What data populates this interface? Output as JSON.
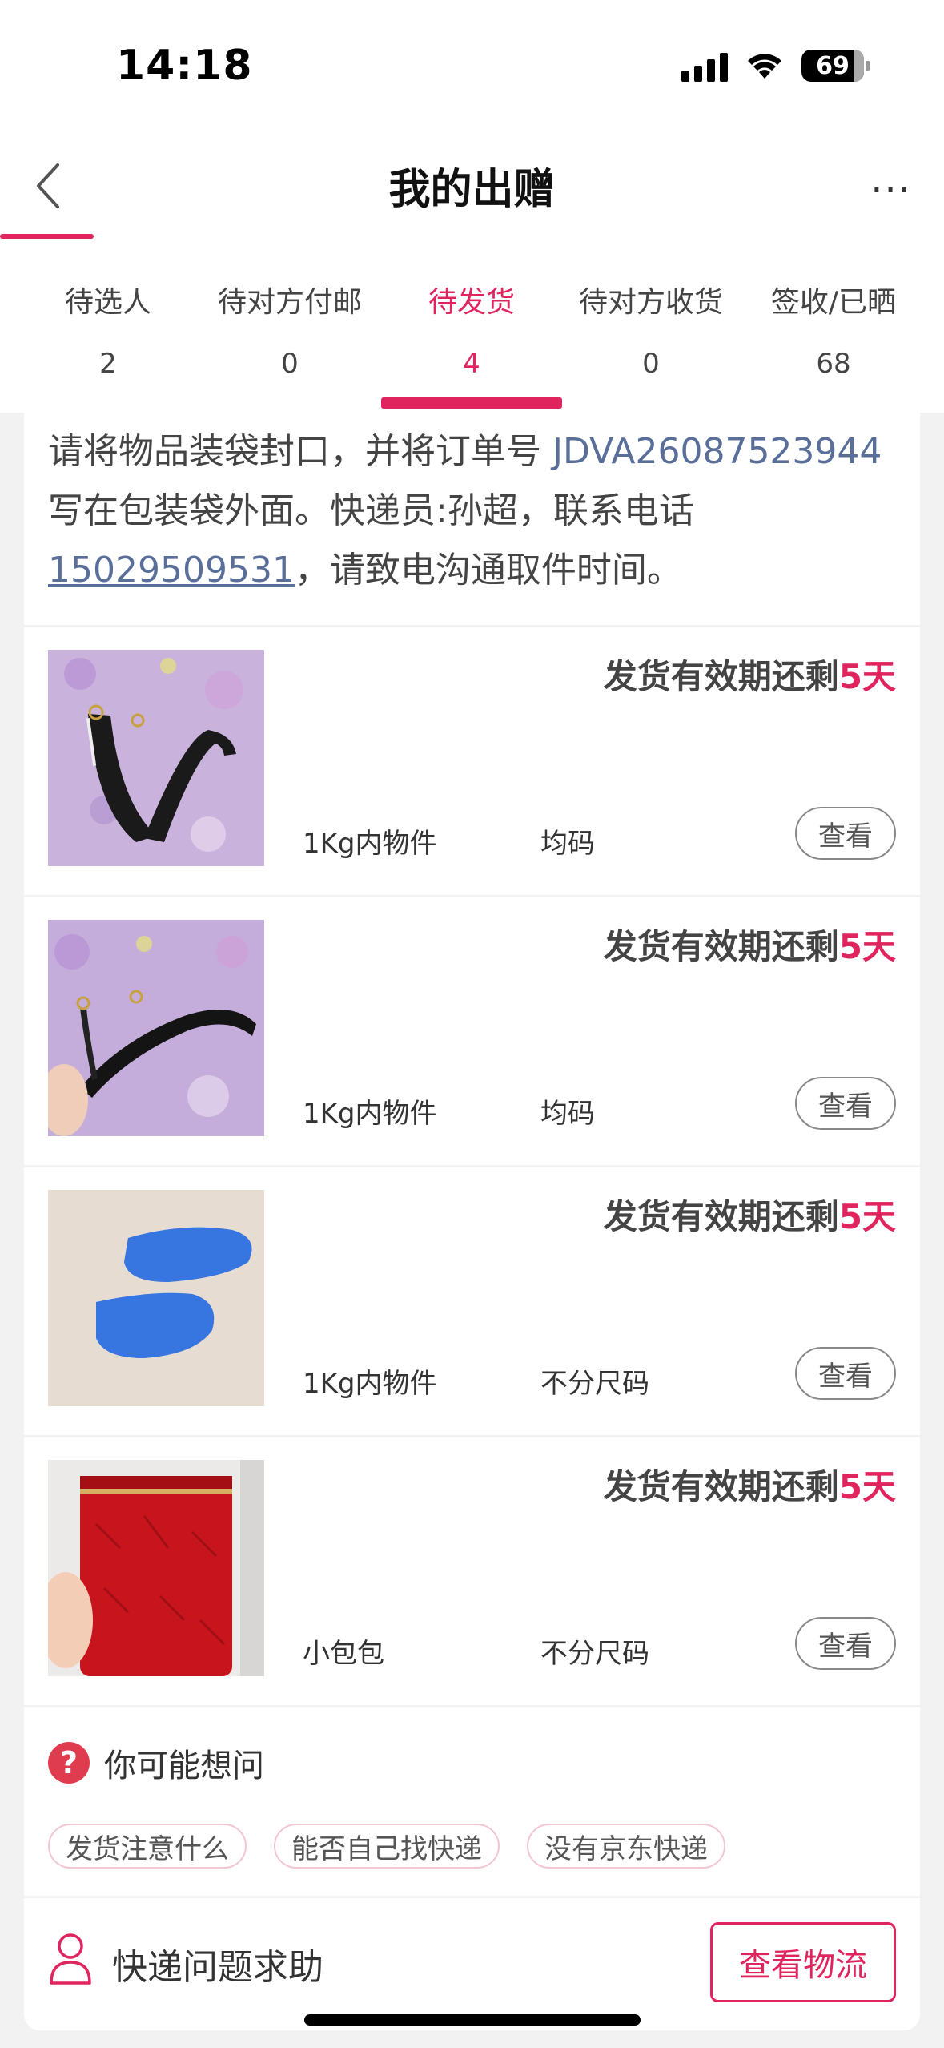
{
  "status_bar": {
    "time": "14:18",
    "battery": "69"
  },
  "nav": {
    "title": "我的出赠",
    "more": "···"
  },
  "tabs": [
    {
      "label": "待选人",
      "count": "2"
    },
    {
      "label": "待对方付邮",
      "count": "0"
    },
    {
      "label": "待发货",
      "count": "4",
      "active": true
    },
    {
      "label": "待对方收货",
      "count": "0"
    },
    {
      "label": "签收/已晒",
      "count": "68"
    }
  ],
  "notice": {
    "text_before": "请将物品装袋封口，并将订单号 ",
    "order_no": "JDVA26087523944",
    "text_middle": " 写在包装袋外面。快递员:孙超，联系电话",
    "phone": "15029509531",
    "text_after": "，请致电沟通取件时间。"
  },
  "items": [
    {
      "deadline_prefix": "发货有效期还剩",
      "deadline_days": "5天",
      "weight": "1Kg内物件",
      "size": "均码",
      "button": "查看",
      "image": "black-strap-on-floral-sheet"
    },
    {
      "deadline_prefix": "发货有效期还剩",
      "deadline_days": "5天",
      "weight": "1Kg内物件",
      "size": "均码",
      "button": "查看",
      "image": "black-strap-held-in-hand"
    },
    {
      "deadline_prefix": "发货有效期还剩",
      "deadline_days": "5天",
      "weight": "1Kg内物件",
      "size": "不分尺码",
      "button": "查看",
      "image": "blue-gel-insoles"
    },
    {
      "deadline_prefix": "发货有效期还剩",
      "deadline_days": "5天",
      "weight": "小包包",
      "size": "不分尺码",
      "button": "查看",
      "image": "red-croc-cylinder-bag"
    }
  ],
  "faq": {
    "title": "你可能想问",
    "icon": "question-icon",
    "chips": [
      "发货注意什么",
      "能否自己找快递",
      "没有京东快递"
    ]
  },
  "help": {
    "label": "快递问题求助",
    "icon": "person-icon",
    "button": "查看物流"
  },
  "colors": {
    "accent": "#e0245e",
    "link": "#5a6e9a"
  }
}
